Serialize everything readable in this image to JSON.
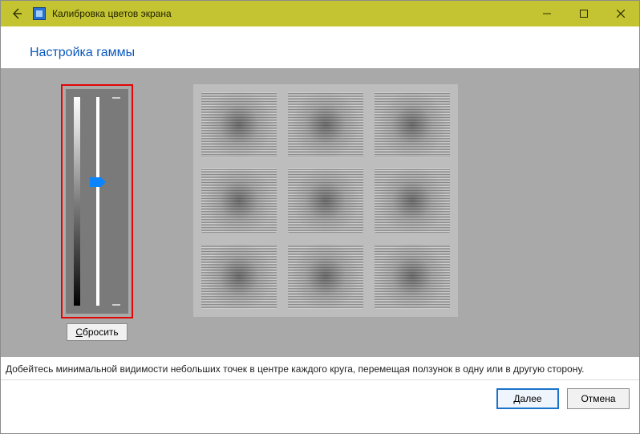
{
  "window": {
    "title": "Калибровка цветов экрана"
  },
  "header": {
    "heading": "Настройка гаммы"
  },
  "slider": {
    "reset_label": "Сбросить",
    "reset_accel_char": "С",
    "value_percent": 50
  },
  "instruction": "Добейтесь минимальной видимости небольших точек в центре каждого круга, перемещая ползунок в одну или в другую сторону.",
  "buttons": {
    "next": "Далее",
    "cancel": "Отмена"
  },
  "icons": {
    "back": "back-arrow",
    "app": "monitor-icon",
    "minimize": "minimize-icon",
    "maximize": "maximize-icon",
    "close": "close-icon"
  },
  "colors": {
    "titlebar_bg": "#c4c432",
    "heading": "#0a58bd",
    "content_bg": "#a9a9a9",
    "highlight_border": "#e40606",
    "slider_thumb": "#0a84ff",
    "primary_border": "#1a72c9"
  }
}
